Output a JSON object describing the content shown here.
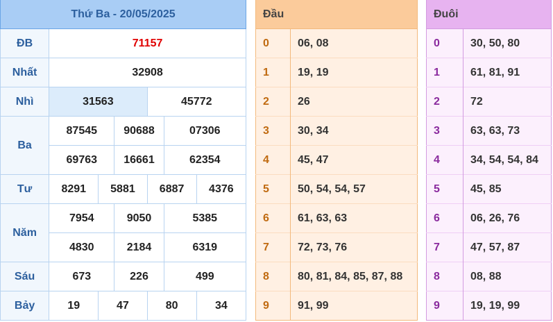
{
  "results": {
    "header": "Thứ Ba - 20/05/2025",
    "prizes": {
      "db": {
        "label": "ĐB",
        "numbers": [
          "71157"
        ]
      },
      "nhat": {
        "label": "Nhất",
        "numbers": [
          "32908"
        ]
      },
      "nhi": {
        "label": "Nhì",
        "numbers": [
          "31563",
          "45772"
        ]
      },
      "ba": {
        "label": "Ba",
        "numbers": [
          "87545",
          "90688",
          "07306",
          "69763",
          "16661",
          "62354"
        ]
      },
      "tu": {
        "label": "Tư",
        "numbers": [
          "8291",
          "5881",
          "6887",
          "4376"
        ]
      },
      "nam": {
        "label": "Năm",
        "numbers": [
          "7954",
          "9050",
          "5385",
          "4830",
          "2184",
          "6319"
        ]
      },
      "sau": {
        "label": "Sáu",
        "numbers": [
          "673",
          "226",
          "499"
        ]
      },
      "bay": {
        "label": "Bảy",
        "numbers": [
          "19",
          "47",
          "80",
          "34"
        ]
      }
    }
  },
  "dau": {
    "header": "Đầu",
    "rows": [
      {
        "key": "0",
        "values": "06, 08"
      },
      {
        "key": "1",
        "values": "19, 19"
      },
      {
        "key": "2",
        "values": "26"
      },
      {
        "key": "3",
        "values": "30, 34"
      },
      {
        "key": "4",
        "values": "45, 47"
      },
      {
        "key": "5",
        "values": "50, 54, 54, 57"
      },
      {
        "key": "6",
        "values": "61, 63, 63"
      },
      {
        "key": "7",
        "values": "72, 73, 76"
      },
      {
        "key": "8",
        "values": "80, 81, 84, 85, 87, 88"
      },
      {
        "key": "9",
        "values": "91, 99"
      }
    ]
  },
  "duoi": {
    "header": "Đuôi",
    "rows": [
      {
        "key": "0",
        "values": "30, 50, 80"
      },
      {
        "key": "1",
        "values": "61, 81, 91"
      },
      {
        "key": "2",
        "values": "72"
      },
      {
        "key": "3",
        "values": "63, 63, 73"
      },
      {
        "key": "4",
        "values": "34, 54, 54, 84"
      },
      {
        "key": "5",
        "values": "45, 85"
      },
      {
        "key": "6",
        "values": "06, 26, 76"
      },
      {
        "key": "7",
        "values": "47, 57, 87"
      },
      {
        "key": "8",
        "values": "08, 88"
      },
      {
        "key": "9",
        "values": "19, 19, 99"
      }
    ]
  }
}
